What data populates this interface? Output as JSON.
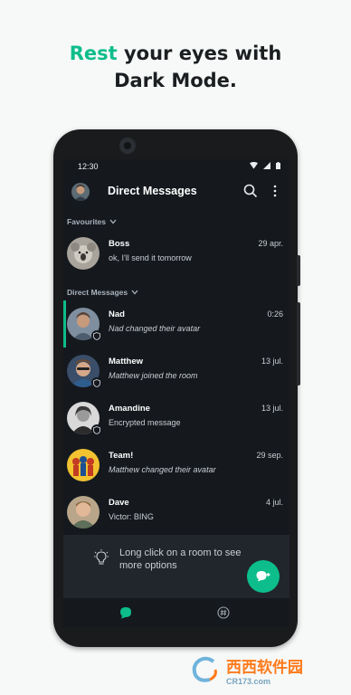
{
  "headline": {
    "accent": "Rest",
    "line1_rest": " your eyes with",
    "line2": "Dark Mode."
  },
  "status_bar": {
    "time": "12:30"
  },
  "app_bar": {
    "title": "Direct Messages"
  },
  "sections": {
    "favourites": "Favourites",
    "direct_messages": "Direct Messages"
  },
  "rooms": [
    {
      "name": "Boss",
      "date": "29 apr.",
      "message": "ok, I'll send it tomorrow",
      "italic": false
    },
    {
      "name": "Nad",
      "date": "0:26",
      "message": "Nad changed their avatar",
      "italic": true
    },
    {
      "name": "Matthew",
      "date": "13 jul.",
      "message": "Matthew joined the room",
      "italic": true
    },
    {
      "name": "Amandine",
      "date": "13 jul.",
      "message": "Encrypted message",
      "italic": false
    },
    {
      "name": "Team!",
      "date": "29 sep.",
      "message": "Matthew changed their avatar",
      "italic": true
    },
    {
      "name": "Dave",
      "date": "4 jul.",
      "message": "Victor: BING",
      "italic": false
    }
  ],
  "hint": {
    "text": "Long click on a room to see more options"
  },
  "watermark": {
    "main": "西西软件园",
    "sub": "CR173.com"
  },
  "colors": {
    "accent": "#0dbd8b",
    "background": "#15191e",
    "watermark": "#ff7a1a"
  },
  "icons": {
    "search": "search-icon",
    "more": "more-vert-icon",
    "chevron": "chevron-down-icon",
    "shield": "shield-icon",
    "bulb": "lightbulb-icon",
    "fab": "new-chat-icon",
    "people_tab": "chat-bubble-icon",
    "rooms_tab": "hash-icon"
  }
}
